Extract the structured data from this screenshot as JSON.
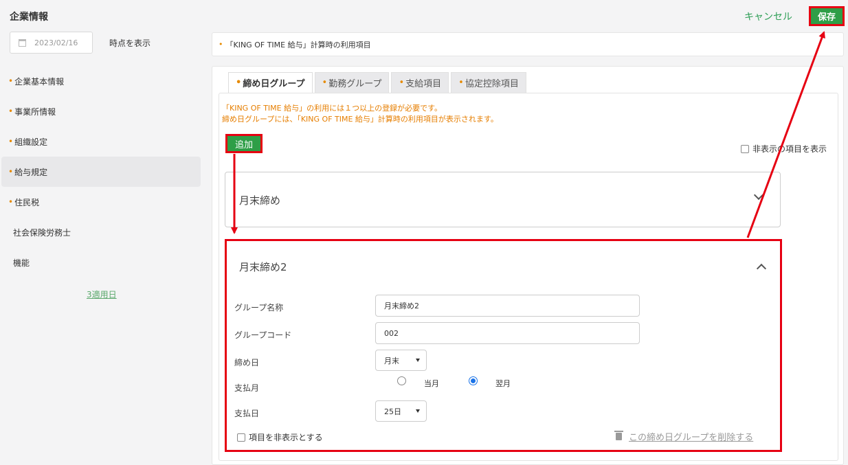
{
  "header": {
    "app_title": "企業情報",
    "date_value": "2023/02/16",
    "time_label": "時点を表示",
    "cancel_label": "キャンセル",
    "save_label": "保存"
  },
  "sidebar": {
    "items": [
      {
        "label": "企業基本情報"
      },
      {
        "label": "事業所情報"
      },
      {
        "label": "組織設定"
      },
      {
        "label": "給与規定"
      },
      {
        "label": "住民税"
      },
      {
        "label": "社会保険労務士"
      },
      {
        "label": "機能"
      }
    ],
    "apply_date_link": "3適用日"
  },
  "notice": {
    "text": "「KING OF TIME 給与」計算時の利用項目"
  },
  "tabs": [
    {
      "label": "締め日グループ"
    },
    {
      "label": "勤務グループ"
    },
    {
      "label": "支給項目"
    },
    {
      "label": "協定控除項目"
    }
  ],
  "content": {
    "message_line1": "「KING OF TIME 給与」の利用には１つ以上の登録が必要です。",
    "message_line2": "締め日グループには、「KING OF TIME 給与」計算時の利用項目が表示されます。",
    "add_label": "追加",
    "show_hidden_label": "非表示の項目を表示"
  },
  "groups": [
    {
      "title": "月末締め"
    },
    {
      "title": "月末締め2"
    }
  ],
  "form": {
    "group_name_label": "グループ名称",
    "group_name_value": "月末締め2",
    "group_code_label": "グループコード",
    "group_code_value": "002",
    "closing_day_label": "締め日",
    "closing_day_value": "月末",
    "pay_month_label": "支払月",
    "pay_month_option1": "当月",
    "pay_month_option2": "翌月",
    "pay_day_label": "支払日",
    "pay_day_value": "25日",
    "hide_item_label": "項目を非表示とする",
    "delete_label": "この締め日グループを削除する"
  },
  "colors": {
    "accent_green": "#2e9e47",
    "highlight_red": "#e60012",
    "orange_text": "#e67e00"
  }
}
